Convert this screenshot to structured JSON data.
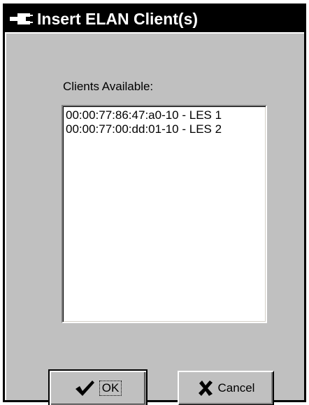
{
  "window": {
    "title": "Insert ELAN Client(s)",
    "title_icon": "connector-plug-icon"
  },
  "clients": {
    "label": "Clients Available:",
    "items": [
      "00:00:77:86:47:a0-10 - LES 1",
      "00:00:77:00:dd:01-10 - LES 2"
    ]
  },
  "buttons": {
    "ok_label": "OK",
    "ok_icon": "checkmark-icon",
    "cancel_label": "Cancel",
    "cancel_icon": "x-mark-icon"
  },
  "colors": {
    "dialog_face": "#c0c0c0",
    "titlebar": "#000000",
    "title_text": "#ffffff",
    "list_background": "#ffffff"
  }
}
